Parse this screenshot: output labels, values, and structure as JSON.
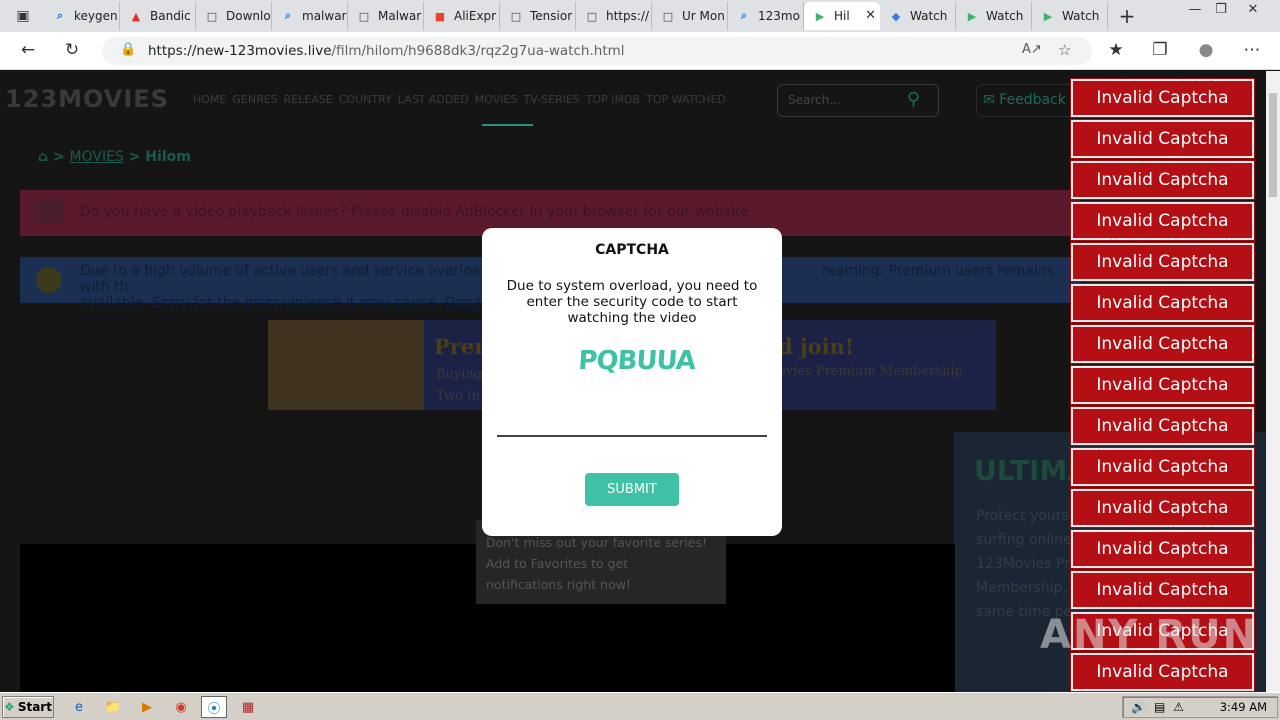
{
  "browser": {
    "tabs": [
      {
        "label": "keygen",
        "icon": "search-icon",
        "active": false
      },
      {
        "label": "Bandic",
        "icon": "bandicam-icon",
        "active": false
      },
      {
        "label": "Downlo",
        "icon": "page-icon",
        "active": false
      },
      {
        "label": "malwar",
        "icon": "search-icon",
        "active": false
      },
      {
        "label": "Malwar",
        "icon": "page-icon",
        "active": false
      },
      {
        "label": "AliExpr",
        "icon": "aliexpress-icon",
        "active": false
      },
      {
        "label": "Tensior",
        "icon": "page-icon",
        "active": false
      },
      {
        "label": "https://",
        "icon": "page-icon",
        "active": false
      },
      {
        "label": "Ur Mon",
        "icon": "page-icon",
        "active": false
      },
      {
        "label": "123mo",
        "icon": "search-icon",
        "active": false
      },
      {
        "label": "Hil",
        "icon": "play-icon",
        "active": true
      },
      {
        "label": "Watch",
        "icon": "drop-icon",
        "active": false
      },
      {
        "label": "Watch",
        "icon": "play-icon",
        "active": false
      },
      {
        "label": "Watch",
        "icon": "play-icon",
        "active": false
      }
    ],
    "url_host": "https://new-123movies.live",
    "url_path": "/film/hilom/h9688dk3/rqz2g7ua-watch.html"
  },
  "site": {
    "logo": "123MOVIES",
    "nav": [
      "HOME",
      "GENRES",
      "RELEASE",
      "COUNTRY",
      "LAST ADDED",
      "MOVIES",
      "TV-SERIES",
      "TOP IMDB",
      "TOP WATCHED"
    ],
    "search_placeholder": "Search...",
    "feedback": "Feedback",
    "breadcrumb_section": "MOVIES",
    "breadcrumb_title": "Hilom",
    "alert_adblock": "Do you have a video playback issues? Please disable AdBlocker in your browser for our website.",
    "alert_overload_1": "Due to a high volume of active users and service overload,",
    "alert_overload_1b": "reaming. Premium users remains with th",
    "alert_overload_2": "available. Sorry for the inconvinience it may cause.",
    "alert_overload_2b": "Donat",
    "banner_title_left": "Prem",
    "banner_title_right": "d join!",
    "banner_sub_left_1": "Buying",
    "banner_sub_left_2": "Two in",
    "banner_sub_right": "ovies Premium Membership.",
    "fav_text": [
      "Don't miss out your favorite series!",
      "Add to Favorites to get",
      "notifications right now!"
    ],
    "sidead_title": "ULTIMAT",
    "sidead_lines": [
      "Protect yours",
      "surfing online",
      "123Movies Pr",
      "Membership,",
      "same time pe"
    ]
  },
  "modal": {
    "title": "CAPTCHA",
    "description": "Due to system overload, you need to enter the security code to start watching the video",
    "captcha_code": "PQBUUA",
    "input_value": "",
    "submit_label": "SUBMIT"
  },
  "notifications": {
    "label": "Invalid Captcha",
    "count": 15
  },
  "watermark": "ANY RUN",
  "taskbar": {
    "start": "Start",
    "clock": "3:49 AM"
  }
}
